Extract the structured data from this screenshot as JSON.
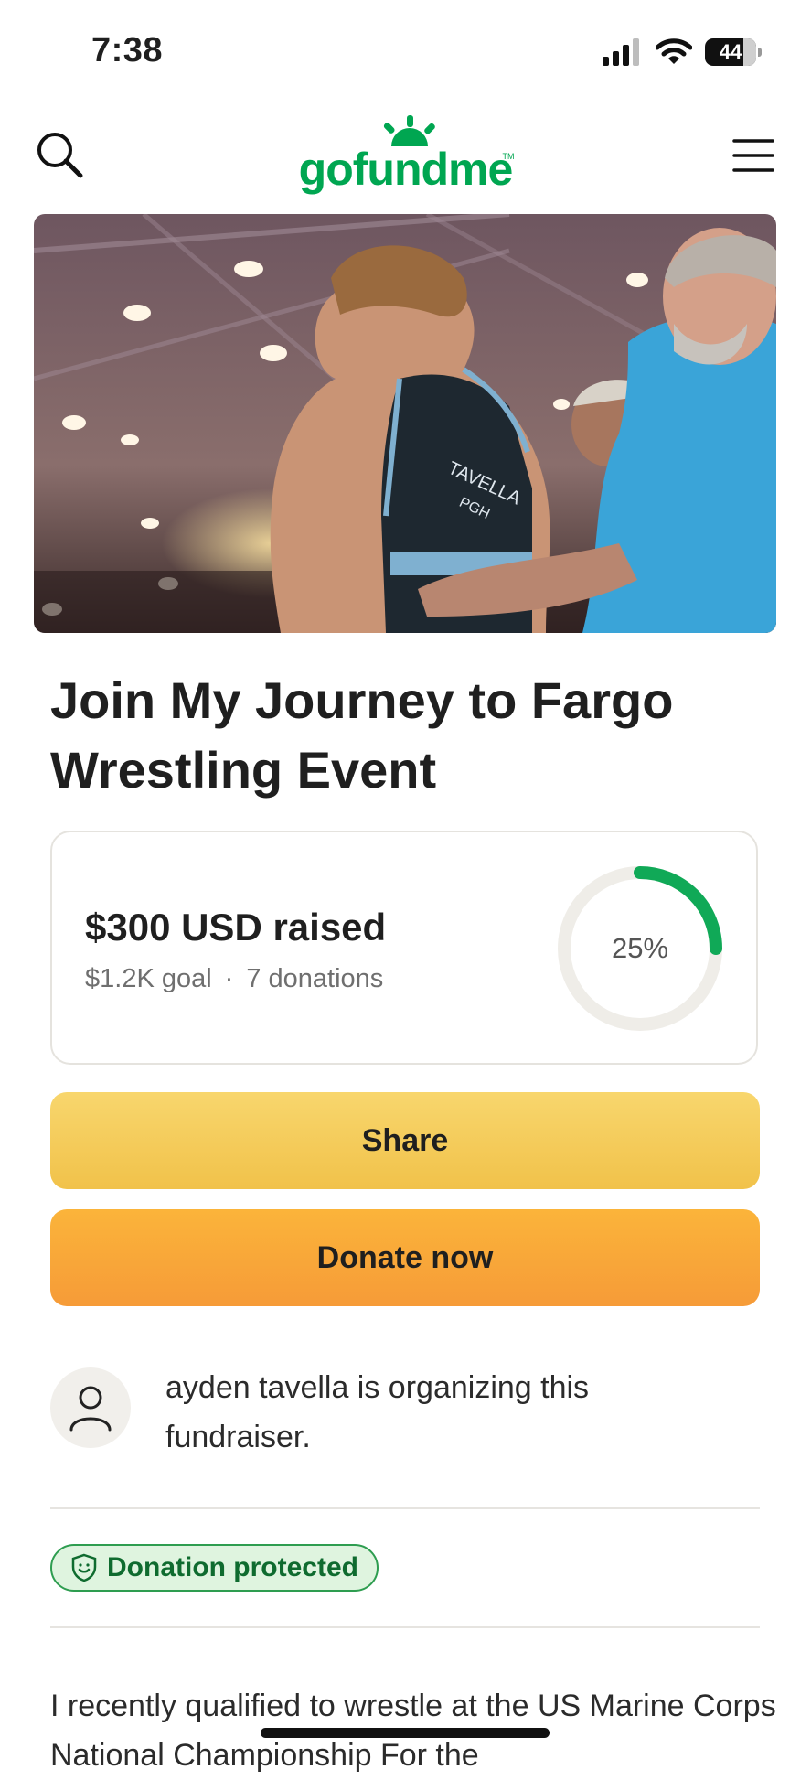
{
  "status_bar": {
    "time": "7:38",
    "battery": "44"
  },
  "header": {
    "logo": "gofundme",
    "logo_tm": "TM"
  },
  "hero": {
    "jersey_name": "TAVELLA",
    "jersey_sub": "PGH"
  },
  "campaign": {
    "title": "Join My Journey to Fargo Wrestling Event",
    "raised": "$300 USD raised",
    "goal": "$1.2K goal",
    "separator": "·",
    "donations": "7 donations",
    "percent_label": "25%",
    "progress_fraction": 0.25
  },
  "actions": {
    "share_label": "Share",
    "donate_label": "Donate now"
  },
  "organizer": {
    "text": "ayden tavella is organizing this fundraiser."
  },
  "badge": {
    "label": "Donation protected"
  },
  "story": {
    "text": "I recently qualified to wrestle at the US Marine Corps National Championship For the"
  },
  "colors": {
    "brand": "#00a651",
    "share": "#f5ce5c",
    "donate": "#f8a63a",
    "progress": "#10a957"
  }
}
